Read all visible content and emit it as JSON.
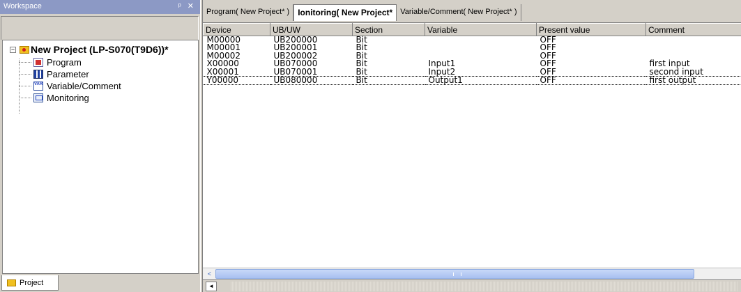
{
  "workspace": {
    "title": "Workspace",
    "controls": "ᵖ ✕",
    "project_label": "New Project (LP-S070(T9D6))*",
    "tree_items": [
      {
        "label": "Program",
        "icon": "program-icon"
      },
      {
        "label": "Parameter",
        "icon": "parameter-icon"
      },
      {
        "label": "Variable/Comment",
        "icon": "variable-icon"
      },
      {
        "label": "Monitoring",
        "icon": "monitoring-icon"
      }
    ],
    "bottom_tab": "Project",
    "expander": "−"
  },
  "tabs": [
    {
      "label": "Program( New Project* )"
    },
    {
      "label": "Ionitoring( New Project*"
    },
    {
      "label": "Variable/Comment( New Project* )"
    }
  ],
  "table": {
    "columns": [
      "Device",
      "UB/UW",
      "Section",
      "Variable",
      "Present value",
      "Comment"
    ],
    "rows": [
      [
        "M00000",
        "UB200000",
        "Bit",
        "",
        "OFF",
        ""
      ],
      [
        "M00001",
        "UB200001",
        "Bit",
        "",
        "OFF",
        ""
      ],
      [
        "M00002",
        "UB200002",
        "Bit",
        "",
        "OFF",
        ""
      ],
      [
        "X00000",
        "UB070000",
        "Bit",
        "Input1",
        "OFF",
        "first input"
      ],
      [
        "X00001",
        "UB070001",
        "Bit",
        "Input2",
        "OFF",
        "second input"
      ],
      [
        "Y00000",
        "UB080000",
        "Bit",
        "Output1",
        "OFF",
        "first output"
      ]
    ]
  },
  "scroll": {
    "left_arrow": "<"
  },
  "nav": {
    "left": "◄"
  }
}
